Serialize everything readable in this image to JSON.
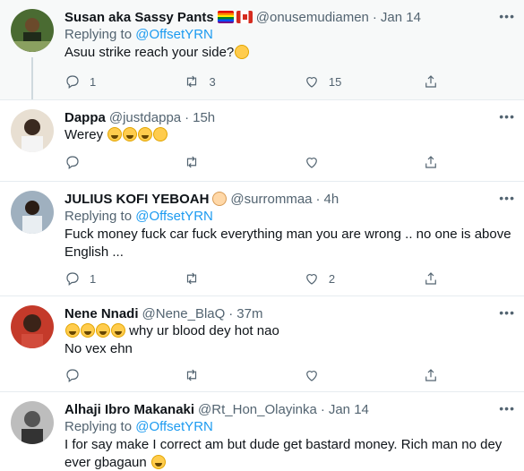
{
  "tweets": [
    {
      "name": "Susan aka Sassy Pants",
      "handle": "@onusemudiamen",
      "sep": "·",
      "time": "Jan 14",
      "replying_prefix": "Replying to ",
      "replying_to": "@OffsetYRN",
      "text": "Asuu strike reach your side?",
      "emoji": [
        "sad-face"
      ],
      "stats": {
        "reply": "1",
        "retweet": "3",
        "like": "15"
      },
      "avatar_color": "#3c5a2a"
    },
    {
      "name": "Dappa",
      "handle": "@justdappa",
      "sep": "·",
      "time": "15h",
      "text": "Werey",
      "emoji": [
        "laughing-tears",
        "laughing-tears",
        "laughing-tears",
        "rolling-laughing"
      ],
      "stats": {
        "reply": "",
        "retweet": "",
        "like": ""
      },
      "avatar_color": "#d9c9b5"
    },
    {
      "name": "JULIUS KOFI YEBOAH",
      "handle": "@surrommaa",
      "sep": "·",
      "time": "4h",
      "replying_prefix": "Replying to ",
      "replying_to": "@OffsetYRN",
      "text_line1": "Fuck money fuck car fuck everything man you are wrong .. no one is above",
      "text_line2": "English ...",
      "stats": {
        "reply": "1",
        "retweet": "",
        "like": "2"
      },
      "avatar_color": "#6b7a8a"
    },
    {
      "name": "Nene Nnadi",
      "handle": "@Nene_BlaQ",
      "sep": "·",
      "time": "37m",
      "text_line1": " why ur blood dey hot nao",
      "text_line2": "No vex ehn",
      "emoji": [
        "laughing-tears",
        "laughing-tears",
        "laughing-tears",
        "laughing-tears"
      ],
      "stats": {
        "reply": "",
        "retweet": "",
        "like": ""
      },
      "avatar_color": "#2b1b14"
    },
    {
      "name": "Alhaji Ibro Makanaki",
      "handle": "@Rt_Hon_Olayinka",
      "sep": "·",
      "time": "Jan 14",
      "replying_prefix": "Replying to ",
      "replying_to": "@OffsetYRN",
      "text_line1": "I for say make I correct am but dude get bastard money. Rich man no dey",
      "text_line2": "ever gbagaun",
      "avatar_color": "#7a7a7a"
    }
  ],
  "more_label": "•••",
  "colors": {
    "link": "#1d9bf0",
    "muted": "#536471",
    "highlight_bg": "#f7f9f9"
  }
}
